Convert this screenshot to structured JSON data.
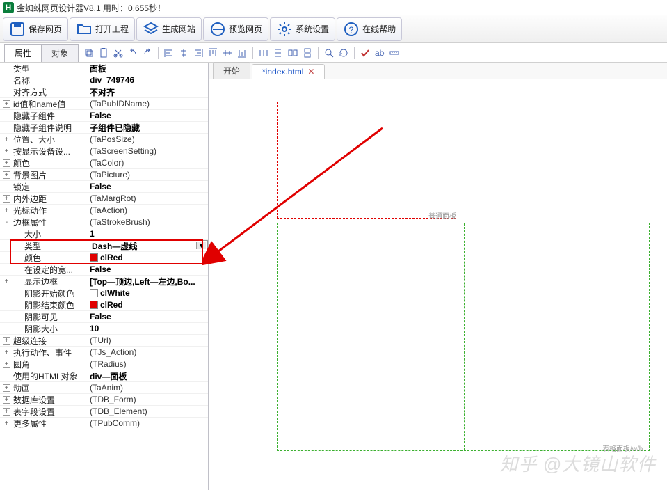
{
  "title": "金蜘蛛网页设计器V8.1  用时：0.655秒！",
  "logo_char": "H",
  "main_buttons": [
    {
      "id": "save",
      "label": "保存网页"
    },
    {
      "id": "open",
      "label": "打开工程"
    },
    {
      "id": "build",
      "label": "生成网站"
    },
    {
      "id": "preview",
      "label": "预览网页"
    },
    {
      "id": "settings",
      "label": "系统设置"
    },
    {
      "id": "help",
      "label": "在线帮助"
    }
  ],
  "left_tabs": {
    "attr": "属性",
    "obj": "对象"
  },
  "doc_tab_start": "开始",
  "doc_tab_file": "*index.html",
  "props": [
    {
      "exp": "",
      "label": "类型",
      "val": "面板",
      "bold": true
    },
    {
      "exp": "",
      "label": "名称",
      "val": "div_749746",
      "bold": true
    },
    {
      "exp": "",
      "label": "对齐方式",
      "val": "不对齐",
      "bold": true
    },
    {
      "exp": "+",
      "label": "id值和name值",
      "val": "(TaPubIDName)"
    },
    {
      "exp": "",
      "label": "隐藏子组件",
      "val": "False",
      "bold": true
    },
    {
      "exp": "",
      "label": "隐藏子组件说明",
      "val": "子组件已隐藏",
      "bold": true
    },
    {
      "exp": "+",
      "label": "位置、大小",
      "val": "(TaPosSize)"
    },
    {
      "exp": "+",
      "label": "按显示设备设...",
      "val": "(TaScreenSetting)"
    },
    {
      "exp": "+",
      "label": "颜色",
      "val": "(TaColor)"
    },
    {
      "exp": "+",
      "label": "背景图片",
      "val": "(TaPicture)"
    },
    {
      "exp": "",
      "label": "锁定",
      "val": "False",
      "bold": true
    },
    {
      "exp": "+",
      "label": "内外边距",
      "val": "(TaMargRot)"
    },
    {
      "exp": "+",
      "label": "光标动作",
      "val": "(TaAction)"
    },
    {
      "exp": "-",
      "label": "边框属性",
      "val": "(TaStrokeBrush)"
    },
    {
      "exp": "",
      "label": "大小",
      "val": "1",
      "bold": true,
      "indent": true
    },
    {
      "exp": "",
      "label": "类型",
      "val": "Dash—虚线",
      "bold": true,
      "indent": true,
      "dropdown": true,
      "hl": true
    },
    {
      "exp": "",
      "label": "颜色",
      "val": "clRed",
      "bold": true,
      "indent": true,
      "swatch": "#e00000",
      "hl": true
    },
    {
      "exp": "",
      "label": "在设定的宽...",
      "val": "False",
      "bold": true,
      "indent": true
    },
    {
      "exp": "+",
      "label": "显示边框",
      "val": "[Top—顶边,Left—左边,Bo...",
      "bold": true,
      "indent": true
    },
    {
      "exp": "",
      "label": "阴影开始颜色",
      "val": "clWhite",
      "bold": true,
      "indent": true,
      "swatch": "#ffffff"
    },
    {
      "exp": "",
      "label": "阴影结束颜色",
      "val": "clRed",
      "bold": true,
      "indent": true,
      "swatch": "#e00000"
    },
    {
      "exp": "",
      "label": "阴影可见",
      "val": "False",
      "bold": true,
      "indent": true
    },
    {
      "exp": "",
      "label": "阴影大小",
      "val": "10",
      "bold": true,
      "indent": true
    },
    {
      "exp": "+",
      "label": "超级连接",
      "val": "(TUrl)"
    },
    {
      "exp": "+",
      "label": "执行动作、事件",
      "val": "(TJs_Action)"
    },
    {
      "exp": "+",
      "label": "圆角",
      "val": "(TRadius)"
    },
    {
      "exp": "",
      "label": "使用的HTML对象",
      "val": "div—面板",
      "bold": true
    },
    {
      "exp": "+",
      "label": "动画",
      "val": "(TaAnim)"
    },
    {
      "exp": "+",
      "label": "数据库设置",
      "val": "(TDB_Form)"
    },
    {
      "exp": "+",
      "label": "表字段设置",
      "val": "(TDB_Element)"
    },
    {
      "exp": "+",
      "label": "更多属性",
      "val": "(TPubComm)"
    }
  ],
  "canvas_labels": {
    "normal_panel": "普通面板",
    "table_panel": "表格面板/w/h"
  },
  "watermark": "知乎 @大镜山软件"
}
